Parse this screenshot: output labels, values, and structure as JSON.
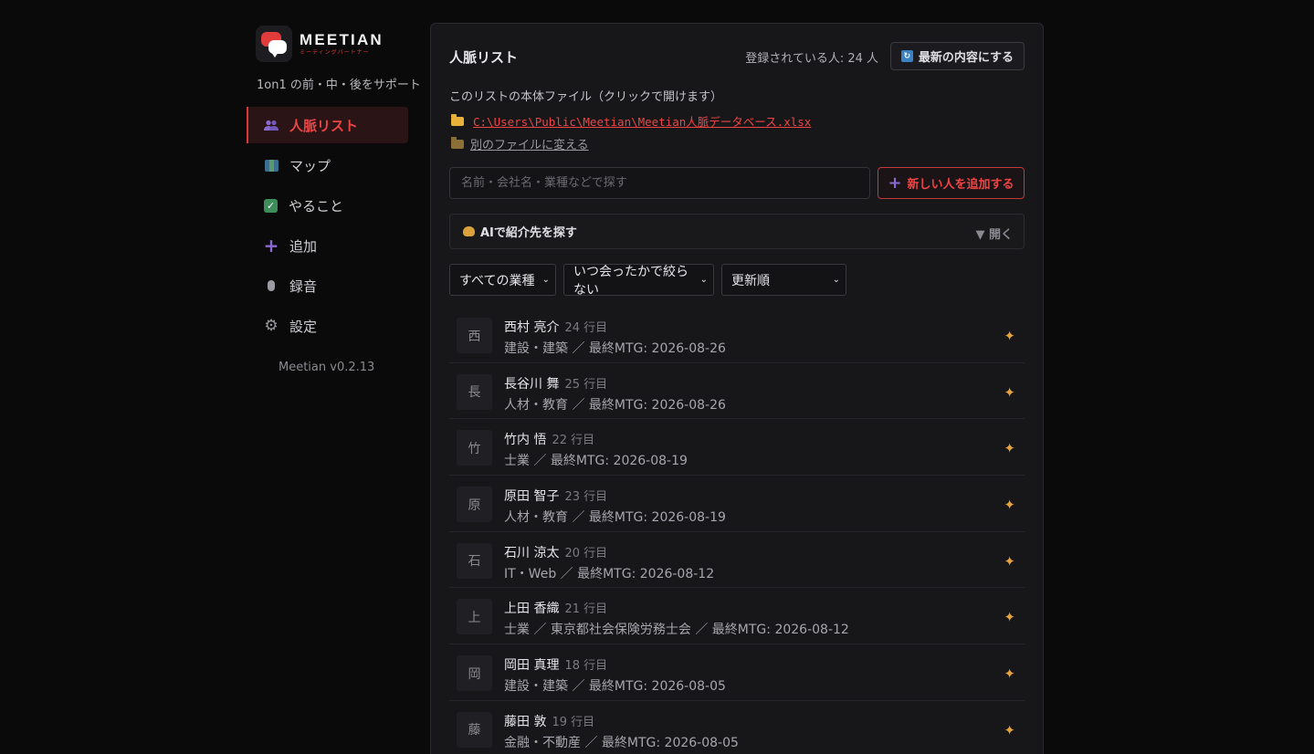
{
  "sidebar": {
    "brand_name": "MEETIAN",
    "brand_sub": "ミーティングパートナー",
    "tagline": "1on1 の前・中・後をサポート",
    "items": [
      {
        "label": "人脈リスト",
        "icon": "people-icon",
        "active": true
      },
      {
        "label": "マップ",
        "icon": "map-icon"
      },
      {
        "label": "やること",
        "icon": "checkbox-icon"
      },
      {
        "label": "追加",
        "icon": "plus-icon"
      },
      {
        "label": "録音",
        "icon": "microphone-icon"
      },
      {
        "label": "設定",
        "icon": "gear-icon"
      }
    ],
    "version": "Meetian v0.2.13"
  },
  "header": {
    "title": "人脈リスト",
    "count": "登録されている人: 24 人",
    "refresh_label": "最新の内容にする"
  },
  "file": {
    "caption": "このリストの本体ファイル（クリックで開けます）",
    "path": "C:\\Users\\Public\\Meetian\\Meetian人脈データベース.xlsx",
    "change_label": "別のファイルに変える"
  },
  "search": {
    "placeholder": "名前・会社名・業種などで探す"
  },
  "add_button": {
    "label": "新しい人を追加する"
  },
  "ai": {
    "label": "AIで紹介先を探す",
    "toggle": "▼ 開く"
  },
  "filters": {
    "industry": "すべての業種",
    "met": "いつ会ったかで絞らない",
    "sort": "更新順"
  },
  "people": [
    {
      "initial": "西",
      "name": "西村 亮介",
      "row": "24 行目",
      "meta": "建設・建築 ／ 最終MTG: 2026-08-26"
    },
    {
      "initial": "長",
      "name": "長谷川 舞",
      "row": "25 行目",
      "meta": "人材・教育 ／ 最終MTG: 2026-08-26"
    },
    {
      "initial": "竹",
      "name": "竹内 悟",
      "row": "22 行目",
      "meta": "士業 ／ 最終MTG: 2026-08-19"
    },
    {
      "initial": "原",
      "name": "原田 智子",
      "row": "23 行目",
      "meta": "人材・教育 ／ 最終MTG: 2026-08-19"
    },
    {
      "initial": "石",
      "name": "石川 涼太",
      "row": "20 行目",
      "meta": "IT・Web ／ 最終MTG: 2026-08-12"
    },
    {
      "initial": "上",
      "name": "上田 香織",
      "row": "21 行目",
      "meta": "士業 ／ 東京都社会保険労務士会 ／ 最終MTG: 2026-08-12"
    },
    {
      "initial": "岡",
      "name": "岡田 真理",
      "row": "18 行目",
      "meta": "建設・建築 ／ 最終MTG: 2026-08-05"
    },
    {
      "initial": "藤",
      "name": "藤田 敦",
      "row": "19 行目",
      "meta": "金融・不動産 ／ 最終MTG: 2026-08-05"
    }
  ],
  "colors": {
    "accent": "#ef4444",
    "background": "#0a0a0b",
    "panel": "#17171a"
  }
}
